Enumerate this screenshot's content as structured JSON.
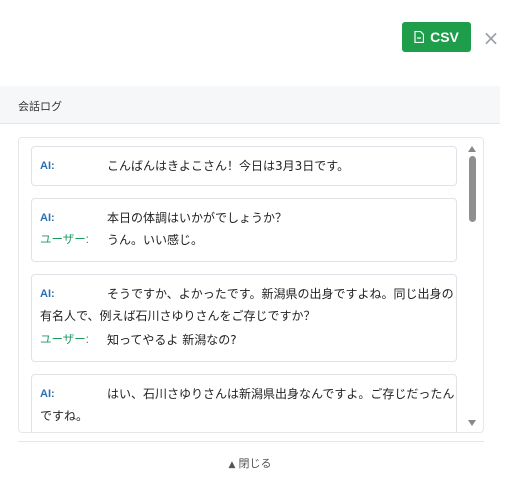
{
  "toolbar": {
    "csv_label": "CSV",
    "csv_icon": "file-icon",
    "close_label": "×",
    "accent": "#1e9e4a"
  },
  "section": {
    "title": "会話ログ"
  },
  "messages": [
    {
      "lines": [
        {
          "speaker": "AI:",
          "role": "ai",
          "text": "こんばんはきよこさん！今日は3月3日です。"
        }
      ]
    },
    {
      "lines": [
        {
          "speaker": "AI:",
          "role": "ai",
          "text": "本日の体調はいかがでしょうか？"
        },
        {
          "speaker": "ユーザー:",
          "role": "user",
          "text": "うん。いい感じ。"
        }
      ]
    },
    {
      "lines": [
        {
          "speaker": "AI:",
          "role": "ai",
          "text": "そうですか、よかったです。新潟県の出身ですよね。同じ出身の",
          "continuation": "有名人で、例えば石川さゆりさんをご存じですか？"
        },
        {
          "speaker": "ユーザー:",
          "role": "user",
          "text": "知ってやるよ 新潟なの?"
        }
      ]
    },
    {
      "lines": [
        {
          "speaker": "AI:",
          "role": "ai",
          "text": "はい、石川さゆりさんは新潟県出身なんですよ。ご存じだったん",
          "continuation": "ですね。"
        }
      ]
    }
  ],
  "footer": {
    "collapse_label": "閉じる",
    "collapse_icon": "triangle-up-icon"
  },
  "colors": {
    "ai_speaker": "#2f6fb0",
    "user_speaker": "#1f9a5f"
  }
}
